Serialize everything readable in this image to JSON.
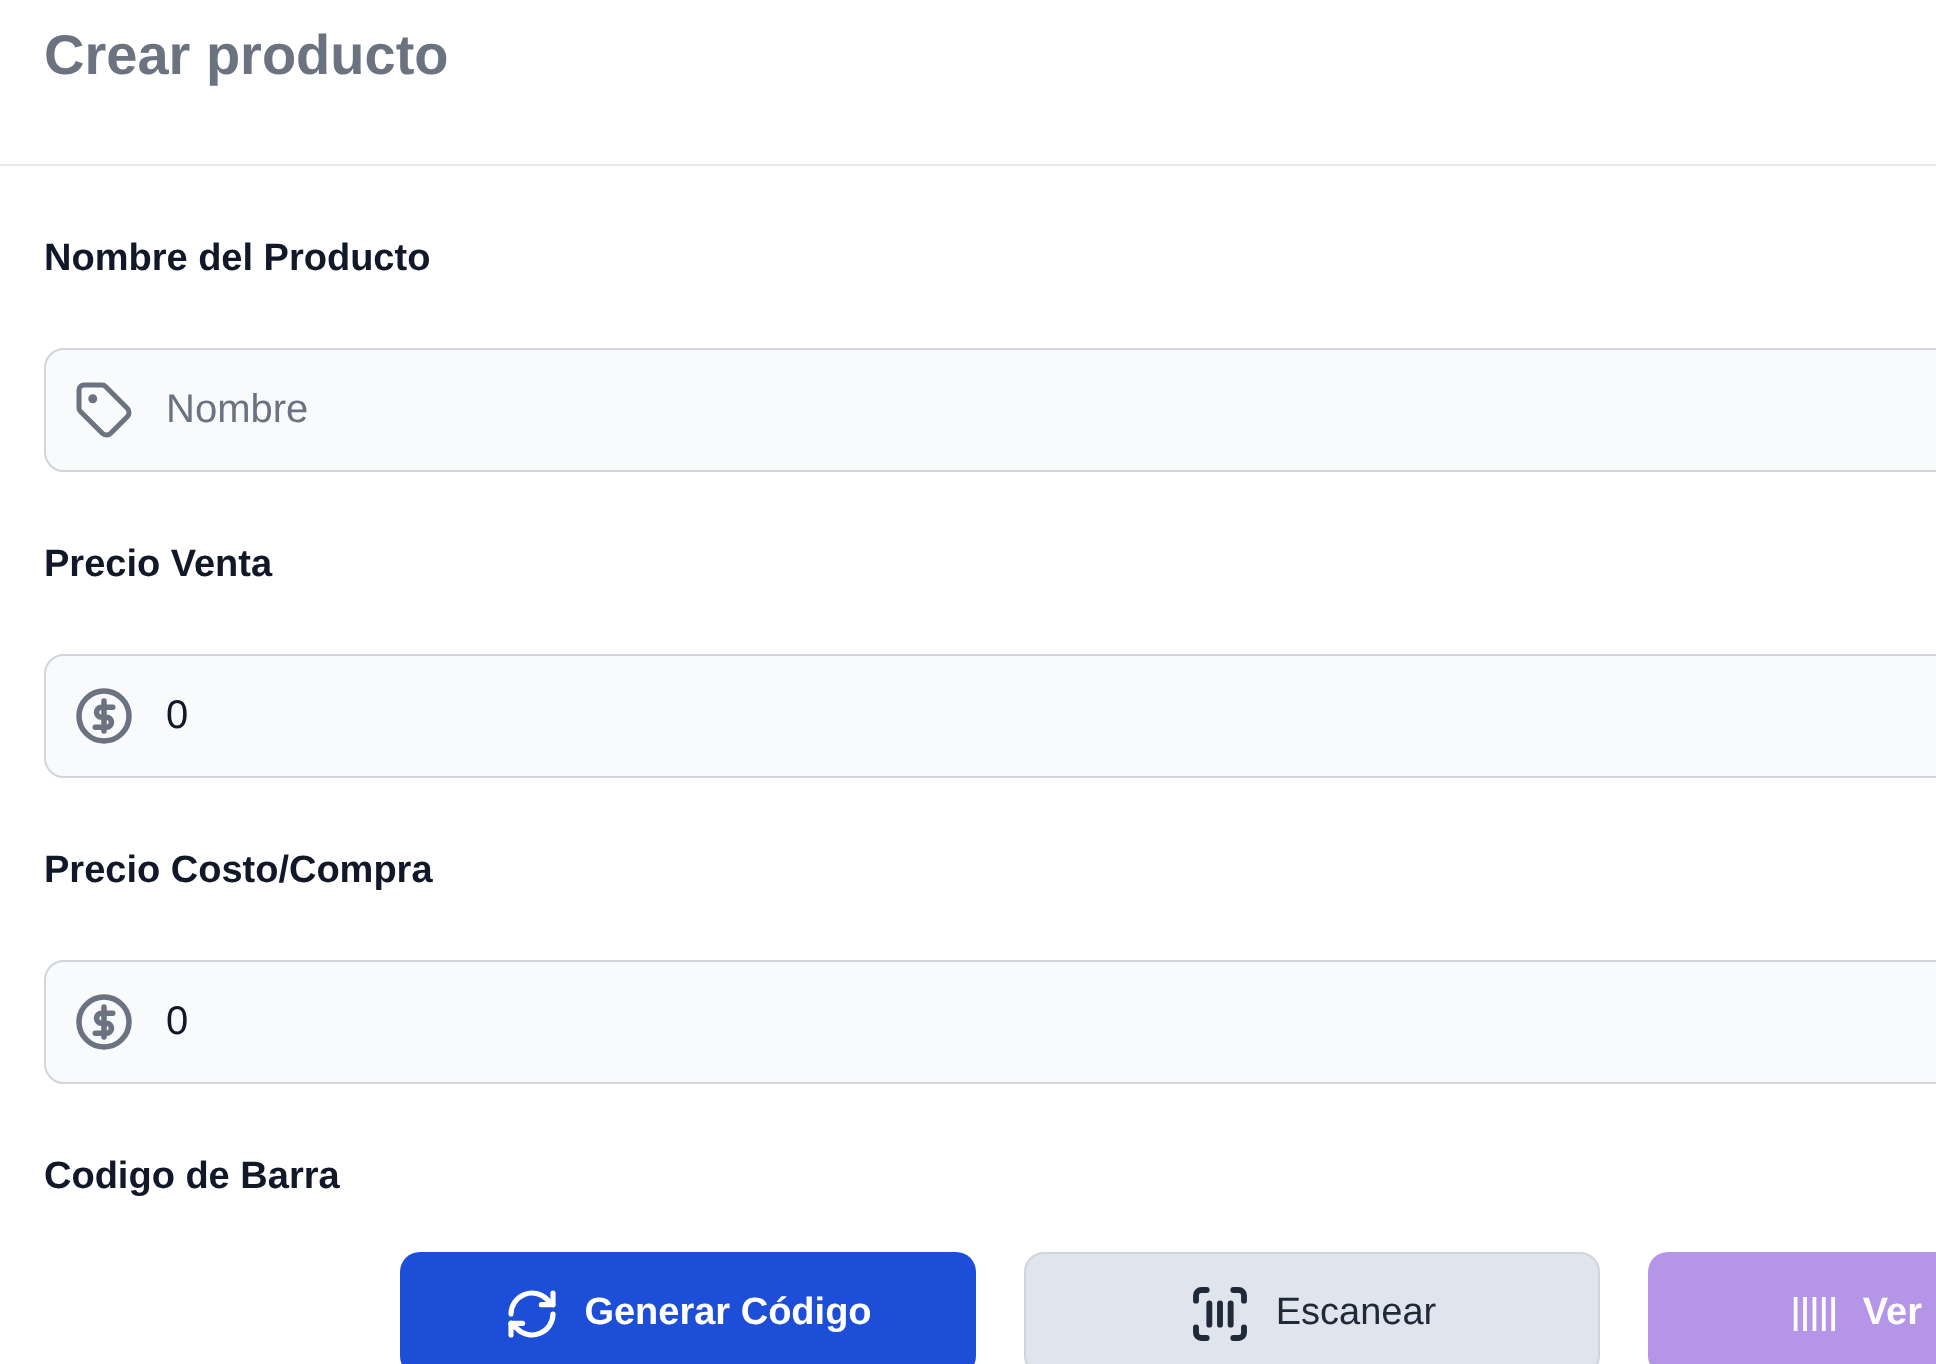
{
  "header": {
    "title": "Crear producto"
  },
  "fields": [
    {
      "label": "Nombre del Producto",
      "kind": "text",
      "placeholder": "Nombre"
    },
    {
      "label": "Precio Venta",
      "kind": "money",
      "value": "0"
    },
    {
      "label": "Precio Costo/Compra",
      "kind": "money",
      "value": "0"
    }
  ],
  "barcode": {
    "label": "Codigo de Barra",
    "buttons": [
      {
        "label": "Generar Código",
        "kind": "generate"
      },
      {
        "label": "Escanear",
        "kind": "scan"
      },
      {
        "label": "Ver",
        "kind": "view"
      }
    ]
  }
}
